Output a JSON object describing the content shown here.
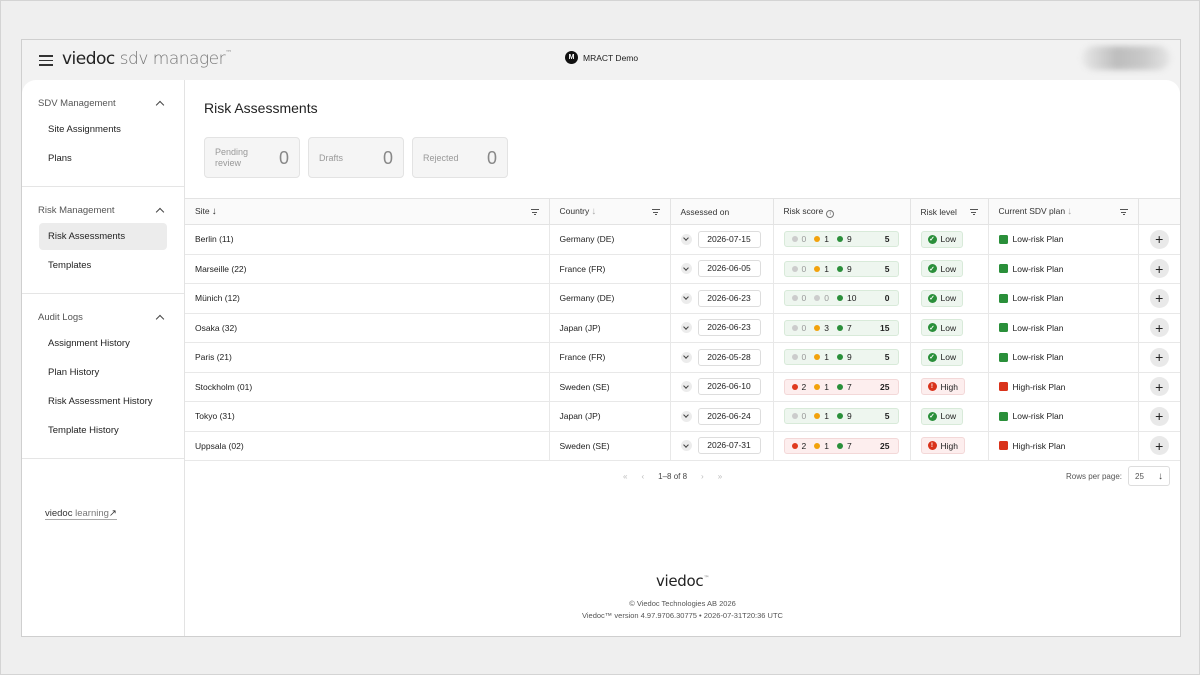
{
  "topbar": {
    "brand_main": "viedoc",
    "brand_sub": " sdv manager",
    "brand_tm": "™",
    "project_initial": "M",
    "project_name": "MRACT Demo"
  },
  "sidebar": {
    "groups": [
      {
        "title": "SDV Management",
        "items": [
          "Site Assignments",
          "Plans"
        ]
      },
      {
        "title": "Risk Management",
        "items": [
          "Risk Assessments",
          "Templates"
        ]
      },
      {
        "title": "Audit Logs",
        "items": [
          "Assignment History",
          "Plan History",
          "Risk Assessment History",
          "Template History"
        ]
      }
    ],
    "learning_a": "viedoc",
    "learning_b": " learning",
    "learning_arrow": "↗"
  },
  "main": {
    "title": "Risk Assessments",
    "stats": [
      {
        "label": "Pending review",
        "value": "0"
      },
      {
        "label": "Drafts",
        "value": "0"
      },
      {
        "label": "Rejected",
        "value": "0"
      }
    ],
    "columns": {
      "site": "Site",
      "country": "Country",
      "assessed": "Assessed on",
      "score": "Risk score",
      "level": "Risk level",
      "plan": "Current SDV plan"
    },
    "rows": [
      {
        "site": "Berlin (11)",
        "country": "Germany (DE)",
        "date": "2026-07-15",
        "red": "0",
        "orange": "1",
        "green": "9",
        "total": "5",
        "level": "Low",
        "plan": "Low-risk Plan"
      },
      {
        "site": "Marseille (22)",
        "country": "France (FR)",
        "date": "2026-06-05",
        "red": "0",
        "orange": "1",
        "green": "9",
        "total": "5",
        "level": "Low",
        "plan": "Low-risk Plan"
      },
      {
        "site": "Münich (12)",
        "country": "Germany (DE)",
        "date": "2026-06-23",
        "red": "0",
        "orange": "0",
        "green": "10",
        "total": "0",
        "level": "Low",
        "plan": "Low-risk Plan"
      },
      {
        "site": "Osaka (32)",
        "country": "Japan (JP)",
        "date": "2026-06-23",
        "red": "0",
        "orange": "3",
        "green": "7",
        "total": "15",
        "level": "Low",
        "plan": "Low-risk Plan"
      },
      {
        "site": "Paris (21)",
        "country": "France (FR)",
        "date": "2026-05-28",
        "red": "0",
        "orange": "1",
        "green": "9",
        "total": "5",
        "level": "Low",
        "plan": "Low-risk Plan"
      },
      {
        "site": "Stockholm (01)",
        "country": "Sweden (SE)",
        "date": "2026-06-10",
        "red": "2",
        "orange": "1",
        "green": "7",
        "total": "25",
        "level": "High",
        "plan": "High-risk Plan"
      },
      {
        "site": "Tokyo (31)",
        "country": "Japan (JP)",
        "date": "2026-06-24",
        "red": "0",
        "orange": "1",
        "green": "9",
        "total": "5",
        "level": "Low",
        "plan": "Low-risk Plan"
      },
      {
        "site": "Uppsala (02)",
        "country": "Sweden (SE)",
        "date": "2026-07-31",
        "red": "2",
        "orange": "1",
        "green": "7",
        "total": "25",
        "level": "High",
        "plan": "High-risk Plan"
      }
    ],
    "pagination": {
      "first": "«",
      "prev": "‹",
      "range": "1–8 of 8",
      "next": "›",
      "last": "»",
      "rows_label": "Rows per page:",
      "rows_value": "25"
    }
  },
  "footer": {
    "logo": "viedoc",
    "logo_tm": "™",
    "copyright": "© Viedoc Technologies AB 2026",
    "version": "Viedoc™ version 4.97.9706.30775  •  2026-07-31T20:36 UTC"
  },
  "colors": {
    "red": "#e03a1e",
    "orange": "#f2a20c",
    "green": "#2a8f3a",
    "grey": "#cccccc"
  }
}
